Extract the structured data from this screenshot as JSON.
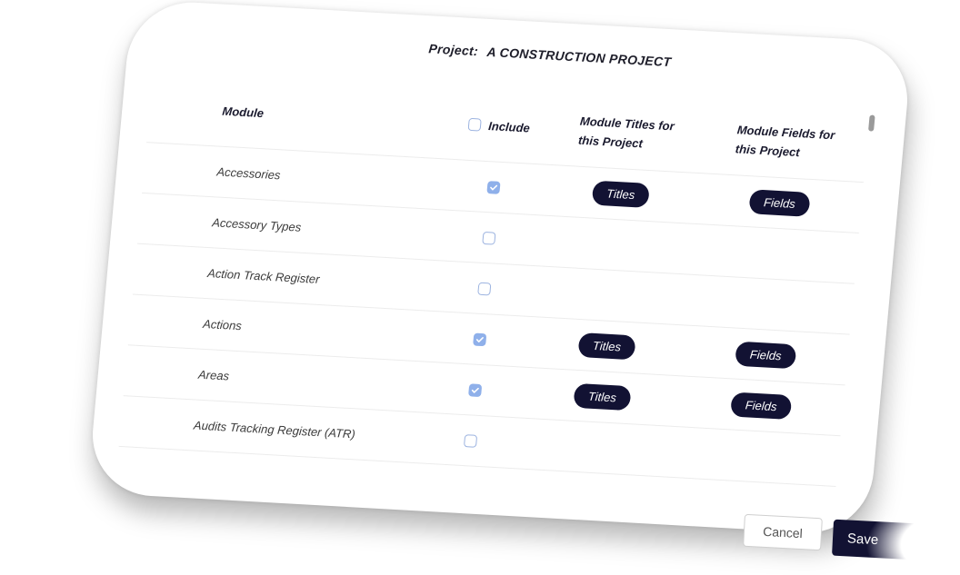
{
  "project": {
    "label": "Project:",
    "name": "A CONSTRUCTION PROJECT"
  },
  "table": {
    "headers": {
      "module": "Module",
      "include": "Include",
      "titles_line1": "Module Titles for",
      "titles_line2": "this Project",
      "fields_line1": "Module Fields for",
      "fields_line2": "this Project"
    },
    "rows": [
      {
        "module": "Accessories",
        "included": true,
        "titles_label": "Titles",
        "fields_label": "Fields"
      },
      {
        "module": "Accessory Types",
        "included": false,
        "titles_label": "",
        "fields_label": ""
      },
      {
        "module": "Action Track Register",
        "included": false,
        "titles_label": "",
        "fields_label": ""
      },
      {
        "module": "Actions",
        "included": true,
        "titles_label": "Titles",
        "fields_label": "Fields"
      },
      {
        "module": "Areas",
        "included": true,
        "titles_label": "Titles",
        "fields_label": "Fields"
      },
      {
        "module": "Audits Tracking Register (ATR)",
        "included": false,
        "titles_label": "",
        "fields_label": ""
      }
    ]
  },
  "footer": {
    "cancel_label": "Cancel",
    "save_label": "Save"
  },
  "colors": {
    "pill": "#121233",
    "checkbox_checked": "#8fb0ea"
  }
}
